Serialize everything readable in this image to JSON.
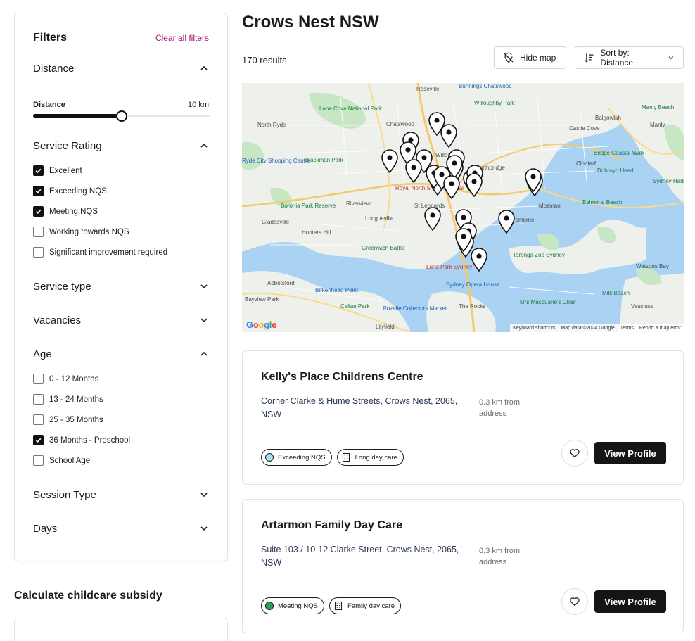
{
  "filters": {
    "title": "Filters",
    "clear_label": "Clear all filters",
    "sections": {
      "distance": {
        "label": "Distance",
        "sub_label": "Distance",
        "value_label": "10 km",
        "slider_fraction": 0.5
      },
      "service_rating": {
        "label": "Service Rating",
        "options": [
          {
            "label": "Excellent",
            "checked": true
          },
          {
            "label": "Exceeding NQS",
            "checked": true
          },
          {
            "label": "Meeting NQS",
            "checked": true
          },
          {
            "label": "Working towards NQS",
            "checked": false
          },
          {
            "label": "Significant improvement required",
            "checked": false
          }
        ]
      },
      "service_type": {
        "label": "Service type"
      },
      "vacancies": {
        "label": "Vacancies"
      },
      "age": {
        "label": "Age",
        "options": [
          {
            "label": "0 - 12 Months",
            "checked": false
          },
          {
            "label": "13 - 24 Months",
            "checked": false
          },
          {
            "label": "25 - 35 Months",
            "checked": false
          },
          {
            "label": "36 Months - Preschool",
            "checked": true
          },
          {
            "label": "School Age",
            "checked": false
          }
        ]
      },
      "session_type": {
        "label": "Session Type"
      },
      "days": {
        "label": "Days"
      }
    }
  },
  "subsidy": {
    "title": "Calculate childcare subsidy"
  },
  "main": {
    "title": "Crows Nest NSW",
    "results_label": "170 results",
    "hide_map_label": "Hide map",
    "sort_label": "Sort by: Distance"
  },
  "map": {
    "labels": [
      "Roseville",
      "Bunnings Chatswood",
      "Lane Cove National Park",
      "Willoughby Park",
      "North Ryde",
      "Chatswood",
      "Willoughby",
      "Castle Cove",
      "Manly Beach",
      "Balgowlah",
      "Manly",
      "Ryde City Shopping Centre",
      "Blackman Park",
      "Northbridge",
      "Bridge Coastal Walk",
      "Clontarf",
      "Dobroyd Head",
      "Royal North Shore Hospital",
      "Riverview",
      "Longueville",
      "St Leonards",
      "Boronia Park Reserve",
      "Balmoral Beach",
      "Mosman",
      "Sydney Harbour National Park",
      "Gladesville",
      "Hunters Hill",
      "Cremorne",
      "Greenwich Baths",
      "Taronga Zoo Sydney",
      "Luna Park Sydney",
      "Abbotsford",
      "Birkenhead Point",
      "Sydney Opera House",
      "Watsons Bay",
      "Milk Beach",
      "Callan Park",
      "Rozelle Collectors Market",
      "Mrs Macquarie's Chair",
      "The Rocks",
      "Vaucluse",
      "Bayview Park",
      "Lilyfield"
    ],
    "google_label": "Google",
    "footer": [
      "Keyboard shortcuts",
      "Map data ©2024 Google",
      "Terms",
      "Report a map error"
    ]
  },
  "listings": [
    {
      "name": "Kelly's Place Childrens Centre",
      "address": "Corner Clarke & Hume Streets, Crows Nest, 2065, NSW",
      "distance": "0.3 km from address",
      "rating_tag": "Exceeding NQS",
      "rating_color": "#a9e4f5",
      "type_tag": "Long day care",
      "view_label": "View Profile"
    },
    {
      "name": "Artarmon Family Day Care",
      "address": "Suite 103 / 10-12 Clarke Street, Crows Nest, 2065, NSW",
      "distance": "0.3 km from address",
      "rating_tag": "Meeting NQS",
      "rating_color": "#2e9e55",
      "type_tag": "Family day care",
      "view_label": "View Profile"
    }
  ],
  "icons": {
    "chevron": "chevron-icon",
    "checkbox": "check-icon",
    "hide_map": "map-pin-off-icon",
    "sort": "sort-icon",
    "heart": "heart-icon",
    "building": "building-icon",
    "location_pin": "location-pin-icon"
  }
}
